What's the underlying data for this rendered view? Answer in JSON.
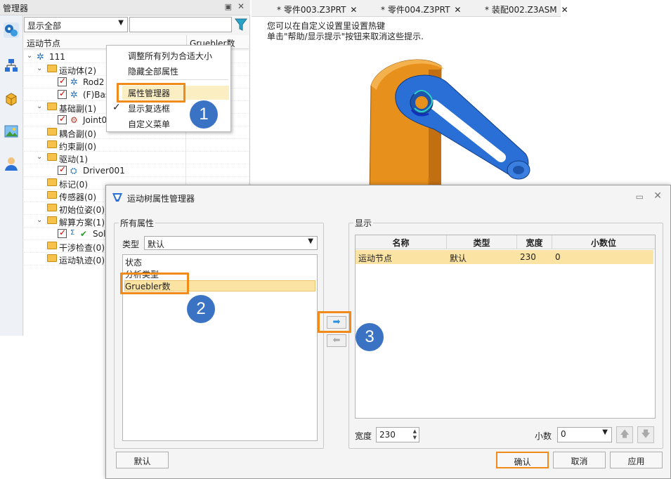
{
  "manager": {
    "title": "管理器",
    "filter_value": "显示全部",
    "column_node": "运动节点",
    "column_gruebler": "Gruebler数",
    "tree": [
      {
        "label": "111"
      },
      {
        "label": "运动体(2)"
      },
      {
        "label": "Rod2"
      },
      {
        "label": "(F)Bas"
      },
      {
        "label": "基础副(1)"
      },
      {
        "label": "Joint00"
      },
      {
        "label": "耦合副(0)"
      },
      {
        "label": "约束副(0)"
      },
      {
        "label": "驱动(1)"
      },
      {
        "label": "Driver001"
      },
      {
        "label": "标记(0)"
      },
      {
        "label": "传感器(0)"
      },
      {
        "label": "初始位姿(0)"
      },
      {
        "label": "解算方案(1)"
      },
      {
        "label": "Sol"
      },
      {
        "label": "干涉检查(0)"
      },
      {
        "label": "运动轨迹(0)"
      }
    ]
  },
  "context_menu": {
    "items": [
      "调整所有列为合适大小",
      "隐藏全部属性",
      "属性管理器",
      "显示复选框",
      "自定义菜单"
    ]
  },
  "tabs": [
    {
      "label": "* 零件003.Z3PRT"
    },
    {
      "label": "* 零件004.Z3PRT"
    },
    {
      "label": "* 装配002.Z3ASM"
    }
  ],
  "viewport": {
    "hint_line1": "您可以在自定义设置里设置热键",
    "hint_line2": "单击\"帮助/显示提示\"按钮来取消这些提示."
  },
  "dialog": {
    "title": "运动树属性管理器",
    "all_props_title": "所有属性",
    "type_label": "类型",
    "type_value": "默认",
    "props": [
      "状态",
      "分析类型",
      "Gruebler数"
    ],
    "display_title": "显示",
    "columns": [
      "名称",
      "类型",
      "宽度",
      "小数位"
    ],
    "row": {
      "name": "运动节点",
      "type": "默认",
      "width": "230",
      "decimals": "0"
    },
    "width_label": "宽度",
    "width_value": "230",
    "decimals_label": "小数",
    "decimals_value": "0",
    "btn_default": "默认",
    "btn_ok": "确认",
    "btn_cancel": "取消",
    "btn_apply": "应用"
  },
  "badges": [
    "1",
    "2",
    "3"
  ],
  "colors": {
    "accent_orange": "#f08a19",
    "badge_blue": "#3b73c4",
    "selection": "#fbe3a4",
    "model_orange": "#e8901c",
    "model_blue": "#2a6fd6"
  }
}
